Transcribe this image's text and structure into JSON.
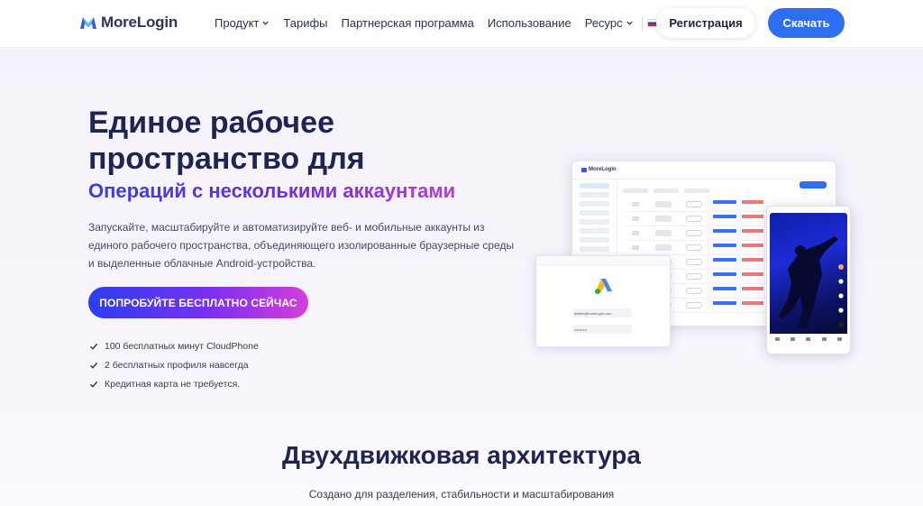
{
  "header": {
    "logo_text": "MoreLogin",
    "nav": [
      {
        "label": "Продукт",
        "has_dropdown": true
      },
      {
        "label": "Тарифы",
        "has_dropdown": false
      },
      {
        "label": "Партнерская программа",
        "has_dropdown": false
      },
      {
        "label": "Использование",
        "has_dropdown": false
      },
      {
        "label": "Ресурс",
        "has_dropdown": true
      }
    ],
    "language": "RU",
    "register_label": "Регистрация",
    "download_label": "Скачать"
  },
  "hero": {
    "title_line1": "Единое рабочее",
    "title_line2": "пространство для",
    "subtitle": "Операций с несколькими аккаунтами",
    "description": "Запускайте, масштабируйте и автоматизируйте веб- и мобильные аккаунты из единого рабочего пространства, объединяющего изолированные браузерные среды и выделенные облачные Android-устройства.",
    "cta_label": "ПОПРОБУЙТЕ БЕСПЛАТНО СЕЙЧАС",
    "checks": [
      "100 бесплатных минут CloudPhone",
      "2 бесплатных профиля навсегда",
      "Кредитная карта не требуется."
    ]
  },
  "mockup": {
    "dashboard_logo": "MoreLogin",
    "login_email": "Admin@morelogin.com",
    "login_password": "••••••••••"
  },
  "section2": {
    "title": "Двухдвижковая архитектура",
    "subtitle": "Создано для разделения, стабильности и масштабирования"
  },
  "colors": {
    "accent_blue": "#2e6ef0",
    "gradient_start": "#2a3ff0",
    "gradient_end": "#d53ddc",
    "title_dark": "#1f2552"
  }
}
